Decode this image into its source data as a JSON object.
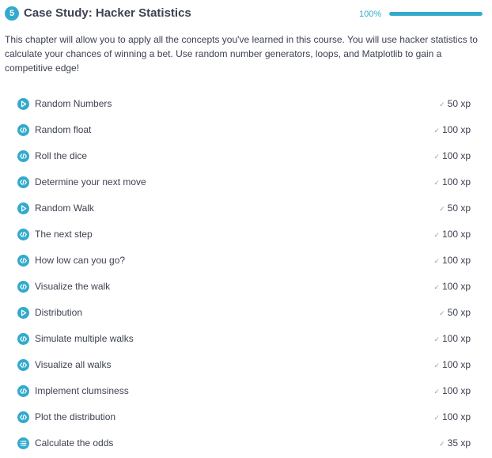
{
  "chapter": {
    "number": "5",
    "title": "Case Study: Hacker Statistics",
    "progress_label": "100%",
    "progress_value": 1.0,
    "description": "This chapter will allow you to apply all the concepts you've learned in this course. You will use hacker statistics to calculate your chances of winning a bet. Use random number generators, loops, and Matplotlib to gain a competitive edge!"
  },
  "colors": {
    "accent": "#33aacc",
    "track": "#d5eaef",
    "text": "#3d4251",
    "muted": "#9aa0aa"
  },
  "exercises": [
    {
      "type": "video",
      "icon": "play-icon",
      "title": "Random Numbers",
      "check": "✓",
      "xp": "50 xp"
    },
    {
      "type": "code",
      "icon": "code-icon",
      "title": "Random float",
      "check": "✓",
      "xp": "100 xp"
    },
    {
      "type": "code",
      "icon": "code-icon",
      "title": "Roll the dice",
      "check": "✓",
      "xp": "100 xp"
    },
    {
      "type": "code",
      "icon": "code-icon",
      "title": "Determine your next move",
      "check": "✓",
      "xp": "100 xp"
    },
    {
      "type": "video",
      "icon": "play-icon",
      "title": "Random Walk",
      "check": "✓",
      "xp": "50 xp"
    },
    {
      "type": "code",
      "icon": "code-icon",
      "title": "The next step",
      "check": "✓",
      "xp": "100 xp"
    },
    {
      "type": "code",
      "icon": "code-icon",
      "title": "How low can you go?",
      "check": "✓",
      "xp": "100 xp"
    },
    {
      "type": "code",
      "icon": "code-icon",
      "title": "Visualize the walk",
      "check": "✓",
      "xp": "100 xp"
    },
    {
      "type": "video",
      "icon": "play-icon",
      "title": "Distribution",
      "check": "✓",
      "xp": "50 xp"
    },
    {
      "type": "code",
      "icon": "code-icon",
      "title": "Simulate multiple walks",
      "check": "✓",
      "xp": "100 xp"
    },
    {
      "type": "code",
      "icon": "code-icon",
      "title": "Visualize all walks",
      "check": "✓",
      "xp": "100 xp"
    },
    {
      "type": "code",
      "icon": "code-icon",
      "title": "Implement clumsiness",
      "check": "✓",
      "xp": "100 xp"
    },
    {
      "type": "code",
      "icon": "code-icon",
      "title": "Plot the distribution",
      "check": "✓",
      "xp": "100 xp"
    },
    {
      "type": "quiz",
      "icon": "list-icon",
      "title": "Calculate the odds",
      "check": "✓",
      "xp": "35 xp"
    }
  ]
}
